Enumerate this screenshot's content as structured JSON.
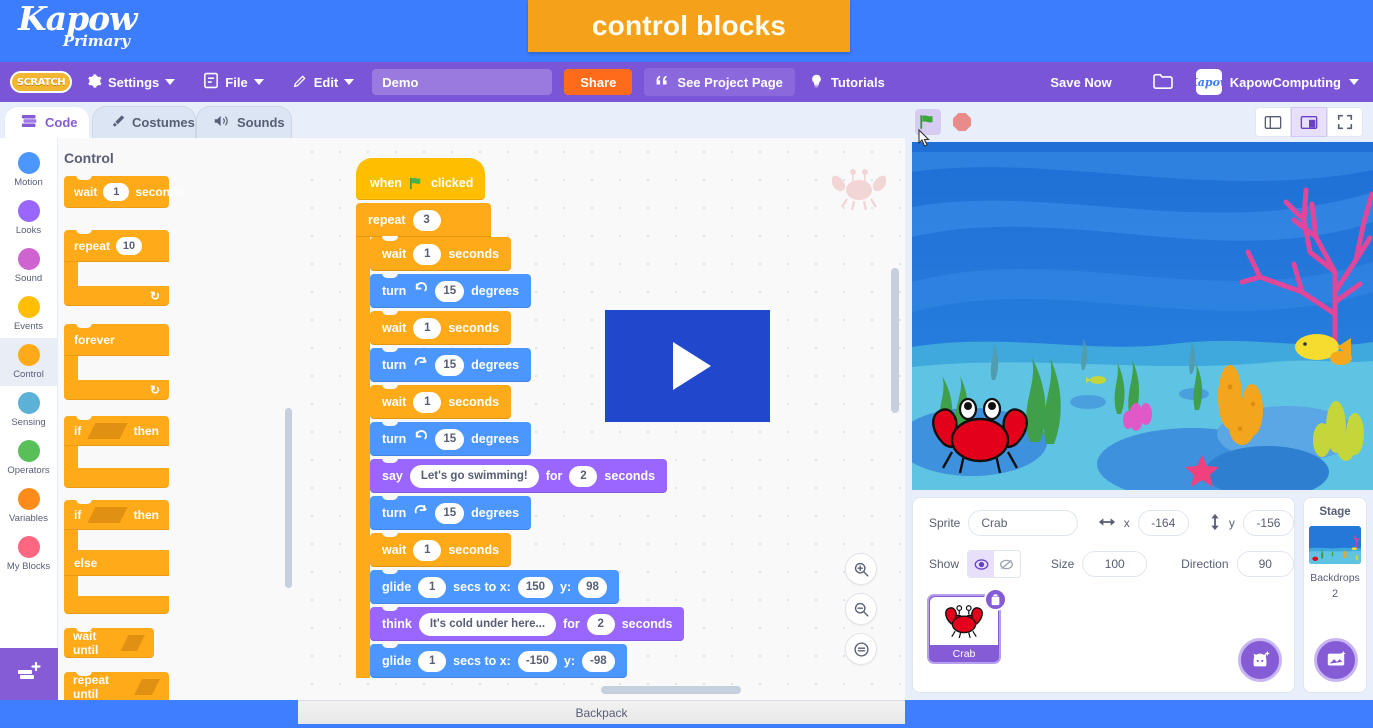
{
  "branding": {
    "logo_word": "Kapow",
    "logo_sub": "Primary",
    "banner_title": "control blocks"
  },
  "menubar": {
    "scratch_logo": "SCRATCH",
    "settings": "Settings",
    "file": "File",
    "edit": "Edit",
    "project_name": "Demo",
    "share": "Share",
    "see_project_page": "See Project Page",
    "tutorials": "Tutorials",
    "save_now": "Save Now",
    "username": "KapowComputing",
    "avatar_text": "Kapow"
  },
  "tabs": [
    {
      "label": "Code",
      "icon": "code-icon",
      "active": true
    },
    {
      "label": "Costumes",
      "icon": "brush-icon",
      "active": false
    },
    {
      "label": "Sounds",
      "icon": "speaker-icon",
      "active": false
    }
  ],
  "categories": [
    {
      "label": "Motion",
      "color": "#4c97ff",
      "active": false
    },
    {
      "label": "Looks",
      "color": "#9966ff",
      "active": false
    },
    {
      "label": "Sound",
      "color": "#cf63cf",
      "active": false
    },
    {
      "label": "Events",
      "color": "#ffbf00",
      "active": false
    },
    {
      "label": "Control",
      "color": "#ffab19",
      "active": true
    },
    {
      "label": "Sensing",
      "color": "#5cb1d6",
      "active": false
    },
    {
      "label": "Operators",
      "color": "#59c059",
      "active": false
    },
    {
      "label": "Variables",
      "color": "#ff8c1a",
      "active": false
    },
    {
      "label": "My Blocks",
      "color": "#ff6680",
      "active": false
    }
  ],
  "palette": {
    "heading": "Control",
    "blocks": [
      {
        "type": "stack",
        "parts": [
          "wait",
          "1",
          "seconds"
        ]
      },
      {
        "type": "c",
        "parts": [
          "repeat",
          "10"
        ]
      },
      {
        "type": "c",
        "parts": [
          "forever"
        ]
      },
      {
        "type": "c",
        "parts": [
          "if",
          "then"
        ]
      },
      {
        "type": "c2",
        "parts": [
          "if",
          "then",
          "else"
        ]
      },
      {
        "type": "stack",
        "parts": [
          "wait until"
        ]
      },
      {
        "type": "c",
        "parts": [
          "repeat until"
        ]
      }
    ],
    "labels": {
      "wait": "wait",
      "seconds": "seconds",
      "repeat": "repeat",
      "forever": "forever",
      "if": "if",
      "then": "then",
      "else": "else",
      "wait_until": "wait until",
      "repeat_until": "repeat until",
      "wait_value": "1",
      "repeat_value": "10"
    }
  },
  "script": {
    "hat": {
      "when": "when",
      "clicked": "clicked",
      "icon": "green-flag-icon"
    },
    "repeat": {
      "label": "repeat",
      "value": "3"
    },
    "body": [
      {
        "kind": "control",
        "label": "wait",
        "value": "1",
        "suffix": "seconds"
      },
      {
        "kind": "motion",
        "label": "turn",
        "icon": "turn-ccw-icon",
        "value": "15",
        "suffix": "degrees"
      },
      {
        "kind": "control",
        "label": "wait",
        "value": "1",
        "suffix": "seconds"
      },
      {
        "kind": "motion",
        "label": "turn",
        "icon": "turn-cw-icon",
        "value": "15",
        "suffix": "degrees"
      },
      {
        "kind": "control",
        "label": "wait",
        "value": "1",
        "suffix": "seconds"
      },
      {
        "kind": "motion",
        "label": "turn",
        "icon": "turn-ccw-icon",
        "value": "15",
        "suffix": "degrees"
      },
      {
        "kind": "looks",
        "label": "say",
        "text": "Let's go swimming!",
        "mid": "for",
        "value": "2",
        "suffix": "seconds"
      },
      {
        "kind": "motion",
        "label": "turn",
        "icon": "turn-cw-icon",
        "value": "15",
        "suffix": "degrees"
      },
      {
        "kind": "control",
        "label": "wait",
        "value": "1",
        "suffix": "seconds"
      },
      {
        "kind": "motion",
        "label": "glide",
        "value": "1",
        "mid": "secs to x:",
        "x": "150",
        "ylabel": "y:",
        "y": "98"
      },
      {
        "kind": "looks",
        "label": "think",
        "text": "It's cold under here...",
        "mid": "for",
        "value": "2",
        "suffix": "seconds"
      },
      {
        "kind": "motion",
        "label": "glide",
        "value": "1",
        "mid": "secs to x:",
        "x": "-150",
        "ylabel": "y:",
        "y": "-98"
      }
    ]
  },
  "canvas_controls": {
    "zoom_in": "zoom-in-icon",
    "zoom_out": "zoom-out-icon",
    "zoom_reset": "zoom-reset-icon"
  },
  "stage_controls": {
    "green_flag": "green-flag-icon",
    "stop": "stop-icon",
    "small_stage": "small-stage-icon",
    "large_stage": "large-stage-icon",
    "fullscreen": "fullscreen-icon"
  },
  "sprite_info": {
    "sprite_label": "Sprite",
    "sprite_name": "Crab",
    "x_label": "x",
    "x_value": "-164",
    "y_label": "y",
    "y_value": "-156",
    "show_label": "Show",
    "size_label": "Size",
    "size_value": "100",
    "direction_label": "Direction",
    "direction_value": "90"
  },
  "sprite_list": [
    {
      "name": "Crab",
      "selected": true
    }
  ],
  "stage_panel": {
    "header": "Stage",
    "backdrops_label": "Backdrops",
    "backdrops_count": "2"
  },
  "buttons": {
    "choose_sprite": "choose-sprite-icon",
    "choose_backdrop": "choose-backdrop-icon"
  },
  "backpack": {
    "label": "Backpack"
  },
  "colors": {
    "control": "#ffab19",
    "motion": "#4c97ff",
    "looks": "#9966ff",
    "events": "#ffbf00",
    "menu_purple": "#7a55d6",
    "brand_blue": "#3b7dfc",
    "banner_orange": "#f5a21a",
    "share_orange": "#ff6b1a"
  }
}
